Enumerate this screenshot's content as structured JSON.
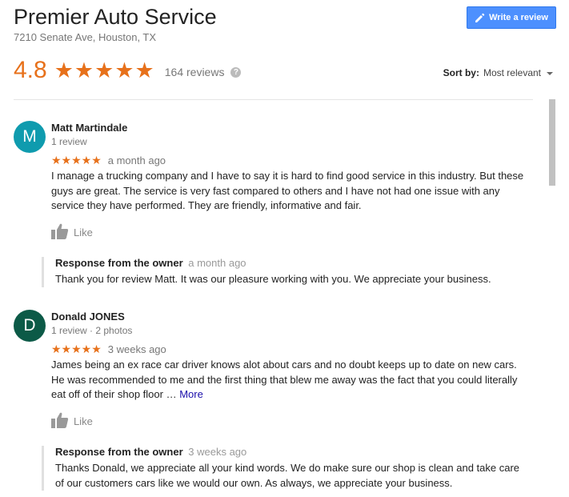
{
  "business": {
    "name": "Premier Auto Service",
    "address": "7210 Senate Ave, Houston, TX",
    "rating": "4.8",
    "rating_stars": 5,
    "review_count": "164 reviews"
  },
  "header": {
    "write_review_label": "Write a review",
    "sort_label": "Sort by:",
    "sort_value": "Most relevant"
  },
  "colors": {
    "accent": "#e7711b",
    "button": "#4d90fe",
    "link": "#1a0dab"
  },
  "reviews": [
    {
      "initial": "M",
      "avatar_color": "#0f9bae",
      "name": "Matt Martindale",
      "meta": "1 review",
      "stars": 5,
      "time": "a month ago",
      "text": "I manage a trucking company and I have to say it is hard to find good service in this industry. But these guys are great. The service is very fast compared to others and I have not had one issue with any service they have performed. They are friendly, informative and fair.",
      "more": "",
      "like_label": "Like",
      "response": {
        "label": "Response from the owner",
        "time": "a month ago",
        "text": "Thank you for review Matt. It was our pleasure working with you. We appreciate your business."
      }
    },
    {
      "initial": "D",
      "avatar_color": "#0c5a47",
      "name": "Donald JONES",
      "meta": "1 review · 2 photos",
      "stars": 5,
      "time": "3 weeks ago",
      "text": "James being an ex race car driver knows alot about cars and no doubt keeps up to date on new cars. He was recommended to me and the first thing that blew me away was the fact that you could literally eat off of their shop floor … ",
      "more": "More",
      "like_label": "Like",
      "response": {
        "label": "Response from the owner",
        "time": "3 weeks ago",
        "text": "Thanks Donald, we appreciate all your kind words. We do make sure our shop is clean and take care of our customers cars like we would our own. As always, we appreciate your business."
      }
    }
  ]
}
